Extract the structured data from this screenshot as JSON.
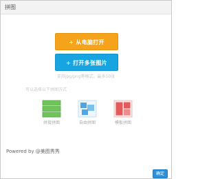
{
  "window": {
    "title": "拼图"
  },
  "actions": {
    "local_label": "+ 从电脑打开",
    "multi_label": "+ 打开多张图片"
  },
  "hints": {
    "limit_text": "支持jpg/png等格式，最多50张",
    "choose_text": "可以选择以下拼图方式"
  },
  "modes": [
    {
      "label": "拼接拼图",
      "icon": "stacked-rows-icon",
      "color": "#6fc35a"
    },
    {
      "label": "自由拼图",
      "icon": "free-collage-icon",
      "color": "#4ea6e2"
    },
    {
      "label": "模板拼图",
      "icon": "template-grid-icon",
      "color": "#e25a5a"
    }
  ],
  "footer": {
    "powered_by": "Powered by @美图秀秀"
  },
  "dialog": {
    "confirm_label": "确定"
  }
}
